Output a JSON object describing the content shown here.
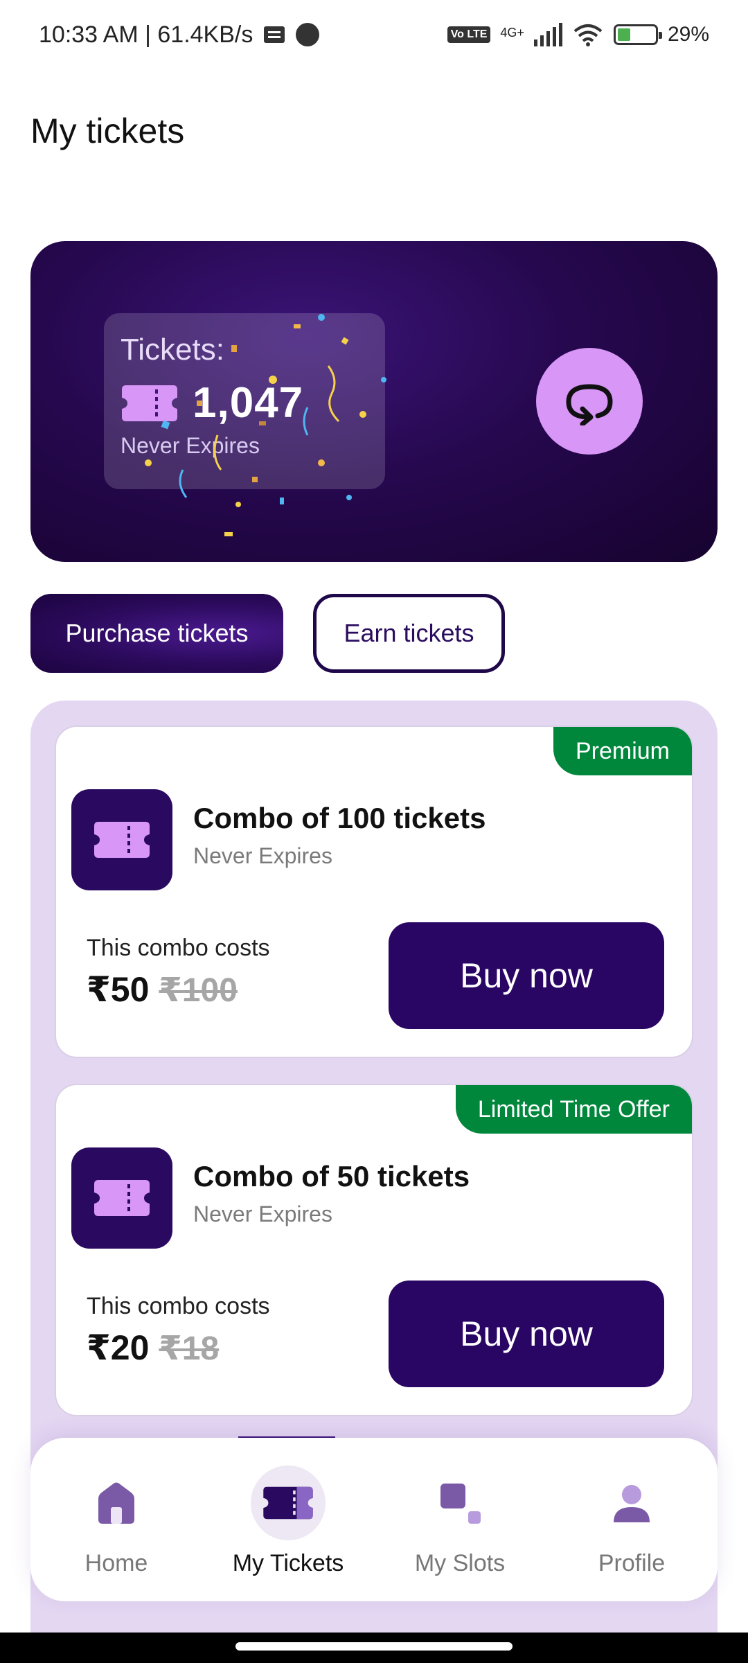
{
  "status_bar": {
    "time_speed": "10:33 AM | 61.4KB/s",
    "network": "4G+",
    "volte": "Vo LTE",
    "battery": "29%"
  },
  "page": {
    "title": "My tickets"
  },
  "hero": {
    "label": "Tickets:",
    "count": "1,047",
    "expiry": "Never Expires"
  },
  "tabs": {
    "purchase": "Purchase tickets",
    "earn": "Earn tickets"
  },
  "offers": [
    {
      "badge": "Premium",
      "title": "Combo of 100 tickets",
      "expiry": "Never Expires",
      "cost_label": "This combo costs",
      "price": "₹50",
      "original_price": "₹100",
      "button": "Buy now"
    },
    {
      "badge": "Limited Time Offer",
      "title": "Combo of 50 tickets",
      "expiry": "Never Expires",
      "cost_label": "This combo costs",
      "price": "₹20",
      "original_price": "₹18",
      "button": "Buy now"
    }
  ],
  "bottom_nav": {
    "items": [
      {
        "label": "Home",
        "icon": "home-icon",
        "active": false
      },
      {
        "label": "My Tickets",
        "icon": "ticket-icon",
        "active": true
      },
      {
        "label": "My Slots",
        "icon": "slots-icon",
        "active": false
      },
      {
        "label": "Profile",
        "icon": "profile-icon",
        "active": false
      }
    ]
  },
  "colors": {
    "brand_dark": "#2a0664",
    "accent_lilac": "#d896f7",
    "badge_green": "#00873c",
    "list_bg": "#e4d7f2"
  }
}
